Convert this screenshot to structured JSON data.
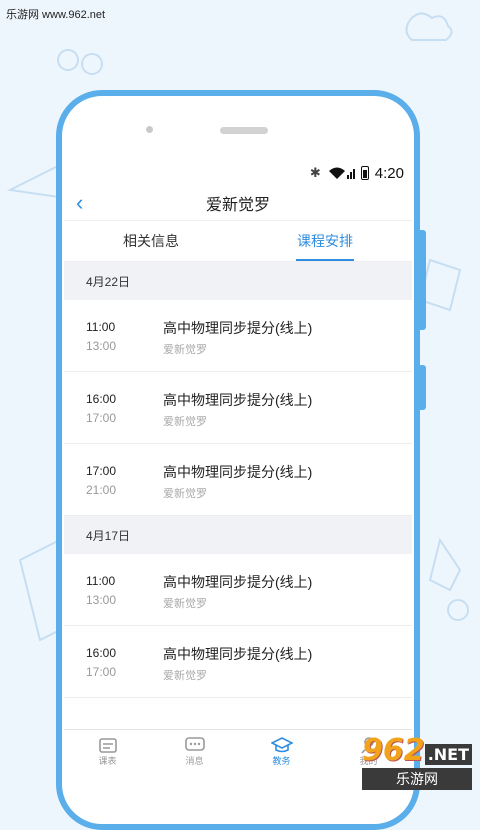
{
  "watermark": "乐游网 www.962.net",
  "status": {
    "time": "4:20"
  },
  "header": {
    "title": "爱新觉罗",
    "back_icon": "chevron-left-icon"
  },
  "tabs": [
    {
      "label": "相关信息",
      "active": false
    },
    {
      "label": "课程安排",
      "active": true
    }
  ],
  "groups": [
    {
      "date": "4月22日",
      "items": [
        {
          "start": "11:00",
          "end": "13:00",
          "course": "高中物理同步提分(线上)",
          "teacher": "爱新觉罗"
        },
        {
          "start": "16:00",
          "end": "17:00",
          "course": "高中物理同步提分(线上)",
          "teacher": "爱新觉罗"
        },
        {
          "start": "17:00",
          "end": "21:00",
          "course": "高中物理同步提分(线上)",
          "teacher": "爱新觉罗"
        }
      ]
    },
    {
      "date": "4月17日",
      "items": [
        {
          "start": "11:00",
          "end": "13:00",
          "course": "高中物理同步提分(线上)",
          "teacher": "爱新觉罗"
        },
        {
          "start": "16:00",
          "end": "17:00",
          "course": "高中物理同步提分(线上)",
          "teacher": "爱新觉罗"
        }
      ]
    }
  ],
  "nav": [
    {
      "label": "课表",
      "icon": "calendar-icon",
      "active": false
    },
    {
      "label": "消息",
      "icon": "chat-icon",
      "active": false
    },
    {
      "label": "教务",
      "icon": "graduation-cap-icon",
      "active": true
    },
    {
      "label": "我的",
      "icon": "user-icon",
      "active": false
    }
  ],
  "brand": {
    "logo_number": "962",
    "logo_net": ".NET",
    "logo_cn": "乐游网"
  },
  "colors": {
    "accent": "#2e8de0",
    "frame": "#5aaee9"
  }
}
